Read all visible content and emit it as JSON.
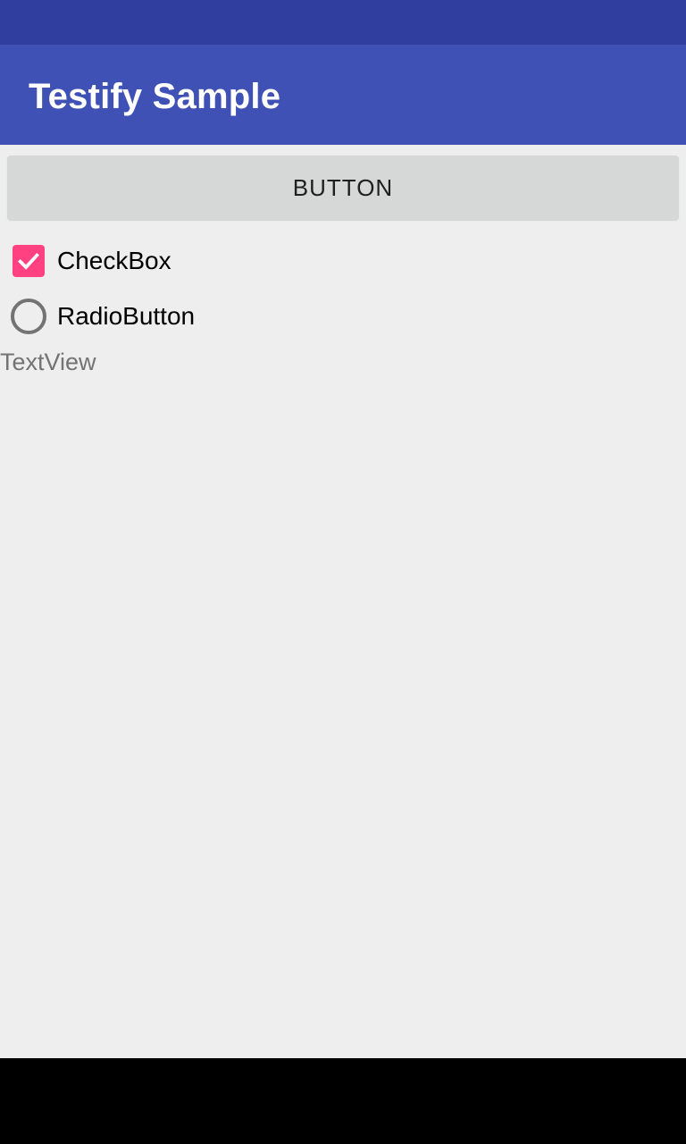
{
  "app_bar": {
    "title": "Testify Sample"
  },
  "content": {
    "button_label": "BUTTON",
    "checkbox": {
      "label": "CheckBox",
      "checked": true
    },
    "radio": {
      "label": "RadioButton",
      "checked": false
    },
    "text_view": "TextView"
  },
  "colors": {
    "status_bar": "#303F9F",
    "primary": "#3F51B5",
    "accent": "#FF4081",
    "background": "#EEEEEE",
    "button": "#D6D7D7"
  },
  "icons": {
    "check": "check-icon"
  }
}
